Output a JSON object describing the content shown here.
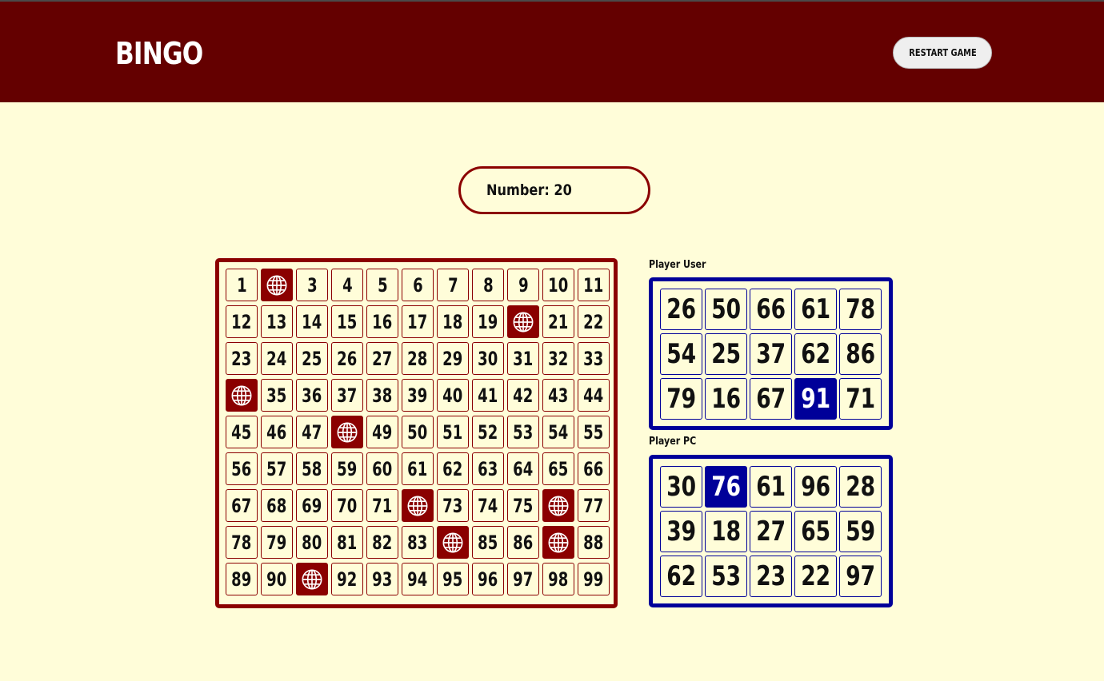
{
  "header": {
    "title": "BINGO",
    "restart_label": "RESTART GAME"
  },
  "draw": {
    "label": "Number: 20"
  },
  "colors": {
    "header_bg": "#640000",
    "page_bg": "#fffdd9",
    "board_accent": "#8b0000",
    "card_accent": "#000099"
  },
  "board": {
    "marked_icon": "globe-icon",
    "cells": [
      {
        "label": "1",
        "marked": false
      },
      {
        "label": "",
        "marked": true
      },
      {
        "label": "3",
        "marked": false
      },
      {
        "label": "4",
        "marked": false
      },
      {
        "label": "5",
        "marked": false
      },
      {
        "label": "6",
        "marked": false
      },
      {
        "label": "7",
        "marked": false
      },
      {
        "label": "8",
        "marked": false
      },
      {
        "label": "9",
        "marked": false
      },
      {
        "label": "10",
        "marked": false
      },
      {
        "label": "11",
        "marked": false
      },
      {
        "label": "12",
        "marked": false
      },
      {
        "label": "13",
        "marked": false
      },
      {
        "label": "14",
        "marked": false
      },
      {
        "label": "15",
        "marked": false
      },
      {
        "label": "16",
        "marked": false
      },
      {
        "label": "17",
        "marked": false
      },
      {
        "label": "18",
        "marked": false
      },
      {
        "label": "19",
        "marked": false
      },
      {
        "label": "",
        "marked": true
      },
      {
        "label": "21",
        "marked": false
      },
      {
        "label": "22",
        "marked": false
      },
      {
        "label": "23",
        "marked": false
      },
      {
        "label": "24",
        "marked": false
      },
      {
        "label": "25",
        "marked": false
      },
      {
        "label": "26",
        "marked": false
      },
      {
        "label": "27",
        "marked": false
      },
      {
        "label": "28",
        "marked": false
      },
      {
        "label": "29",
        "marked": false
      },
      {
        "label": "30",
        "marked": false
      },
      {
        "label": "31",
        "marked": false
      },
      {
        "label": "32",
        "marked": false
      },
      {
        "label": "33",
        "marked": false
      },
      {
        "label": "",
        "marked": true
      },
      {
        "label": "35",
        "marked": false
      },
      {
        "label": "36",
        "marked": false
      },
      {
        "label": "37",
        "marked": false
      },
      {
        "label": "38",
        "marked": false
      },
      {
        "label": "39",
        "marked": false
      },
      {
        "label": "40",
        "marked": false
      },
      {
        "label": "41",
        "marked": false
      },
      {
        "label": "42",
        "marked": false
      },
      {
        "label": "43",
        "marked": false
      },
      {
        "label": "44",
        "marked": false
      },
      {
        "label": "45",
        "marked": false
      },
      {
        "label": "46",
        "marked": false
      },
      {
        "label": "47",
        "marked": false
      },
      {
        "label": "",
        "marked": true
      },
      {
        "label": "49",
        "marked": false
      },
      {
        "label": "50",
        "marked": false
      },
      {
        "label": "51",
        "marked": false
      },
      {
        "label": "52",
        "marked": false
      },
      {
        "label": "53",
        "marked": false
      },
      {
        "label": "54",
        "marked": false
      },
      {
        "label": "55",
        "marked": false
      },
      {
        "label": "56",
        "marked": false
      },
      {
        "label": "57",
        "marked": false
      },
      {
        "label": "58",
        "marked": false
      },
      {
        "label": "59",
        "marked": false
      },
      {
        "label": "60",
        "marked": false
      },
      {
        "label": "61",
        "marked": false
      },
      {
        "label": "62",
        "marked": false
      },
      {
        "label": "63",
        "marked": false
      },
      {
        "label": "64",
        "marked": false
      },
      {
        "label": "65",
        "marked": false
      },
      {
        "label": "66",
        "marked": false
      },
      {
        "label": "67",
        "marked": false
      },
      {
        "label": "68",
        "marked": false
      },
      {
        "label": "69",
        "marked": false
      },
      {
        "label": "70",
        "marked": false
      },
      {
        "label": "71",
        "marked": false
      },
      {
        "label": "",
        "marked": true
      },
      {
        "label": "73",
        "marked": false
      },
      {
        "label": "74",
        "marked": false
      },
      {
        "label": "75",
        "marked": false
      },
      {
        "label": "",
        "marked": true
      },
      {
        "label": "77",
        "marked": false
      },
      {
        "label": "78",
        "marked": false
      },
      {
        "label": "79",
        "marked": false
      },
      {
        "label": "80",
        "marked": false
      },
      {
        "label": "81",
        "marked": false
      },
      {
        "label": "82",
        "marked": false
      },
      {
        "label": "83",
        "marked": false
      },
      {
        "label": "",
        "marked": true
      },
      {
        "label": "85",
        "marked": false
      },
      {
        "label": "86",
        "marked": false
      },
      {
        "label": "",
        "marked": true
      },
      {
        "label": "88",
        "marked": false
      },
      {
        "label": "89",
        "marked": false
      },
      {
        "label": "90",
        "marked": false
      },
      {
        "label": "",
        "marked": true
      },
      {
        "label": "92",
        "marked": false
      },
      {
        "label": "93",
        "marked": false
      },
      {
        "label": "94",
        "marked": false
      },
      {
        "label": "95",
        "marked": false
      },
      {
        "label": "96",
        "marked": false
      },
      {
        "label": "97",
        "marked": false
      },
      {
        "label": "98",
        "marked": false
      },
      {
        "label": "99",
        "marked": false
      }
    ]
  },
  "players": [
    {
      "name": "Player User",
      "cells": [
        {
          "value": "26",
          "hit": false
        },
        {
          "value": "50",
          "hit": false
        },
        {
          "value": "66",
          "hit": false
        },
        {
          "value": "61",
          "hit": false
        },
        {
          "value": "78",
          "hit": false
        },
        {
          "value": "54",
          "hit": false
        },
        {
          "value": "25",
          "hit": false
        },
        {
          "value": "37",
          "hit": false
        },
        {
          "value": "62",
          "hit": false
        },
        {
          "value": "86",
          "hit": false
        },
        {
          "value": "79",
          "hit": false
        },
        {
          "value": "16",
          "hit": false
        },
        {
          "value": "67",
          "hit": false
        },
        {
          "value": "91",
          "hit": true
        },
        {
          "value": "71",
          "hit": false
        }
      ]
    },
    {
      "name": "Player PC",
      "cells": [
        {
          "value": "30",
          "hit": false
        },
        {
          "value": "76",
          "hit": true
        },
        {
          "value": "61",
          "hit": false
        },
        {
          "value": "96",
          "hit": false
        },
        {
          "value": "28",
          "hit": false
        },
        {
          "value": "39",
          "hit": false
        },
        {
          "value": "18",
          "hit": false
        },
        {
          "value": "27",
          "hit": false
        },
        {
          "value": "65",
          "hit": false
        },
        {
          "value": "59",
          "hit": false
        },
        {
          "value": "62",
          "hit": false
        },
        {
          "value": "53",
          "hit": false
        },
        {
          "value": "23",
          "hit": false
        },
        {
          "value": "22",
          "hit": false
        },
        {
          "value": "97",
          "hit": false
        }
      ]
    }
  ]
}
